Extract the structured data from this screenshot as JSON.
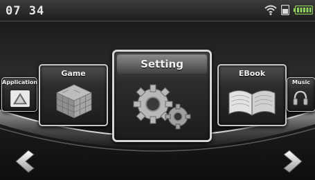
{
  "status": {
    "time": "07 34",
    "wifi_icon": "wifi-icon",
    "sim_icon": "sim-card-icon",
    "battery_icon": "battery-full-icon"
  },
  "carousel": {
    "items": [
      {
        "label": "Application",
        "icon": "warning-triangle-icon",
        "position": "far-left"
      },
      {
        "label": "Game",
        "icon": "puzzle-cube-icon",
        "position": "left"
      },
      {
        "label": "Setting",
        "icon": "gears-icon",
        "position": "center",
        "selected": true
      },
      {
        "label": "EBook",
        "icon": "open-book-icon",
        "position": "right"
      },
      {
        "label": "Music",
        "icon": "headphones-icon",
        "position": "far-right"
      }
    ],
    "prev_icon": "chevron-left-icon",
    "next_icon": "chevron-right-icon"
  },
  "colors": {
    "frame": "#d6d6d6",
    "background": "#1c1c1c",
    "text": "#f2f2f2"
  }
}
